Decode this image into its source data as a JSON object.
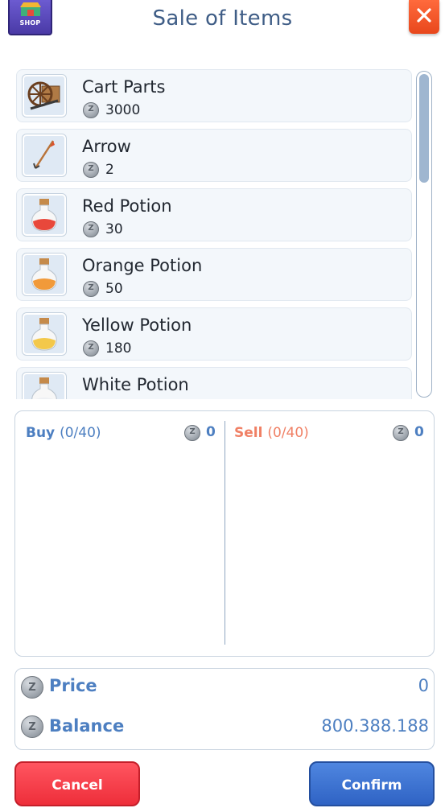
{
  "header": {
    "title": "Sale of Items",
    "badge_label": "SHOP"
  },
  "items": [
    {
      "name": "Cart Parts",
      "price": "3000",
      "icon": "cart-parts-icon"
    },
    {
      "name": "Arrow",
      "price": "2",
      "icon": "arrow-icon"
    },
    {
      "name": "Red Potion",
      "price": "30",
      "icon": "red-potion-icon",
      "color": "#e8483b"
    },
    {
      "name": "Orange Potion",
      "price": "50",
      "icon": "orange-potion-icon",
      "color": "#f19a3a"
    },
    {
      "name": "Yellow Potion",
      "price": "180",
      "icon": "yellow-potion-icon",
      "color": "#f3c84a"
    },
    {
      "name": "White Potion",
      "price": "",
      "icon": "white-potion-icon",
      "color": "#eef0f3"
    }
  ],
  "trade": {
    "buy_label": "Buy",
    "buy_count": "(0/40)",
    "buy_total": "0",
    "sell_label": "Sell",
    "sell_count": "(0/40)",
    "sell_total": "0"
  },
  "summary": {
    "price_label": "Price",
    "price_value": "0",
    "balance_label": "Balance",
    "balance_value": "800.388.188"
  },
  "buttons": {
    "cancel": "Cancel",
    "confirm": "Confirm"
  },
  "colors": {
    "accent_blue": "#4d7fc1",
    "sell_orange": "#f08065",
    "cancel_red": "#ee2e3a",
    "close_orange": "#e8471c"
  }
}
